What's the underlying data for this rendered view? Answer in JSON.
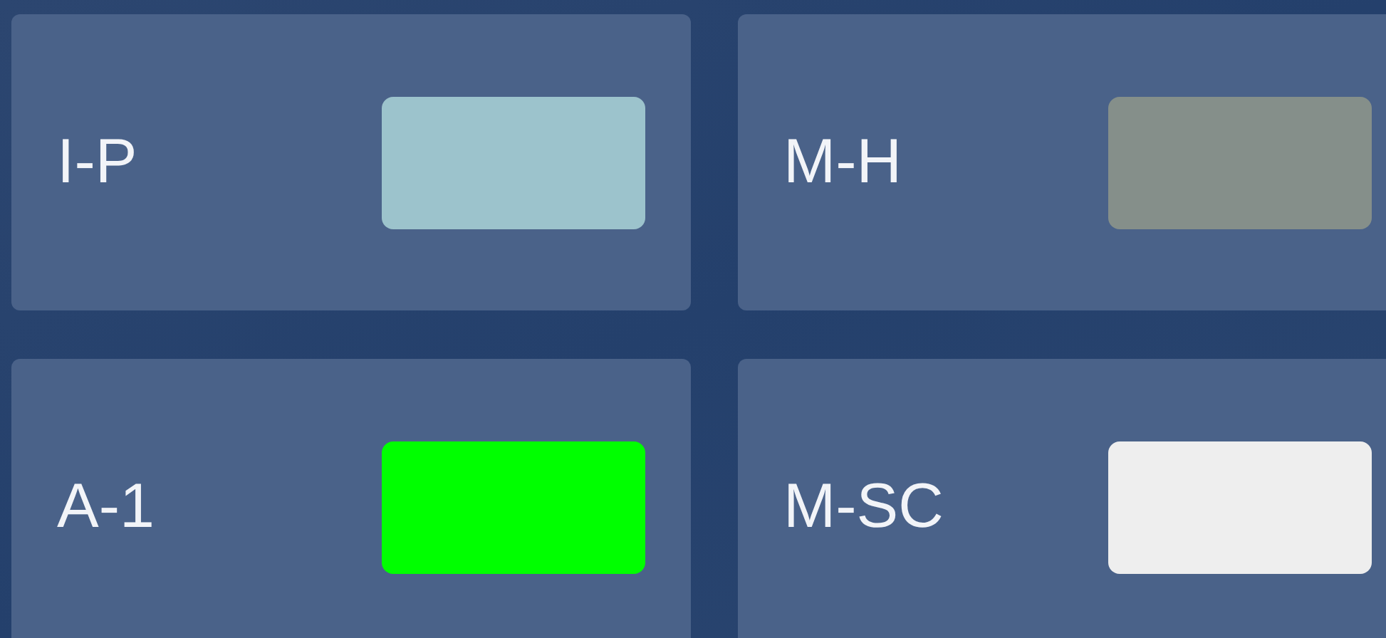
{
  "cards": [
    {
      "label": "I-P",
      "color": "#9cc3cc"
    },
    {
      "label": "M-H",
      "color": "#858f8a"
    },
    {
      "label": "A-1",
      "color": "#00ff00"
    },
    {
      "label": "M-SC",
      "color": "#eeeeee"
    }
  ]
}
